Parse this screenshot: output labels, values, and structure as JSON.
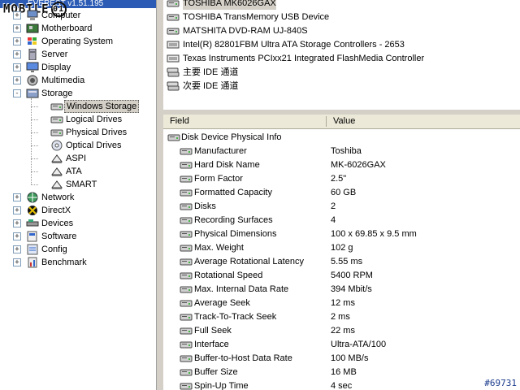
{
  "window": {
    "title": "EVEREST v1.51.195"
  },
  "watermark": {
    "text": "MOBILE",
    "circle": "01"
  },
  "tree": [
    {
      "label": "Computer",
      "icon": "computer-icon",
      "level": 0,
      "expander": "+"
    },
    {
      "label": "Motherboard",
      "icon": "motherboard-icon",
      "level": 0,
      "expander": "+"
    },
    {
      "label": "Operating System",
      "icon": "windows-icon",
      "level": 0,
      "expander": "+"
    },
    {
      "label": "Server",
      "icon": "server-icon",
      "level": 0,
      "expander": "+"
    },
    {
      "label": "Display",
      "icon": "monitor-icon",
      "level": 0,
      "expander": "+"
    },
    {
      "label": "Multimedia",
      "icon": "speaker-icon",
      "level": 0,
      "expander": "+"
    },
    {
      "label": "Storage",
      "icon": "storage-icon",
      "level": 0,
      "expander": "-"
    },
    {
      "label": "Windows Storage",
      "icon": "drive-icon",
      "level": 1,
      "selected": true
    },
    {
      "label": "Logical Drives",
      "icon": "drive-icon",
      "level": 1
    },
    {
      "label": "Physical Drives",
      "icon": "drive-icon",
      "level": 1
    },
    {
      "label": "Optical Drives",
      "icon": "cdrom-icon",
      "level": 1
    },
    {
      "label": "ASPI",
      "icon": "aspi-icon",
      "level": 1
    },
    {
      "label": "ATA",
      "icon": "ata-icon",
      "level": 1
    },
    {
      "label": "SMART",
      "icon": "smart-icon",
      "level": 1
    },
    {
      "label": "Network",
      "icon": "network-icon",
      "level": 0,
      "expander": "+"
    },
    {
      "label": "DirectX",
      "icon": "directx-icon",
      "level": 0,
      "expander": "+"
    },
    {
      "label": "Devices",
      "icon": "devices-icon",
      "level": 0,
      "expander": "+"
    },
    {
      "label": "Software",
      "icon": "software-icon",
      "level": 0,
      "expander": "+"
    },
    {
      "label": "Config",
      "icon": "config-icon",
      "level": 0,
      "expander": "+"
    },
    {
      "label": "Benchmark",
      "icon": "benchmark-icon",
      "level": 0,
      "expander": "+"
    }
  ],
  "devices": [
    {
      "label": "TOSHIBA MK6026GAX",
      "icon": "hard-drive-icon",
      "selected": true
    },
    {
      "label": "TOSHIBA TransMemory USB Device",
      "icon": "usb-drive-icon"
    },
    {
      "label": "MATSHITA DVD-RAM UJ-840S",
      "icon": "dvd-drive-icon"
    },
    {
      "label": "Intel(R) 82801FBM Ultra ATA Storage Controllers - 2653",
      "icon": "controller-icon"
    },
    {
      "label": "Texas Instruments PCIxx21 Integrated FlashMedia Controller",
      "icon": "controller-icon"
    },
    {
      "label": "主要 IDE 通道",
      "icon": "ide-channel-icon"
    },
    {
      "label": "次要 IDE 通道",
      "icon": "ide-channel-icon"
    }
  ],
  "details": {
    "columns": {
      "field": "Field",
      "value": "Value"
    },
    "group": "Disk Device Physical Info",
    "rows": [
      {
        "field": "Manufacturer",
        "value": "Toshiba"
      },
      {
        "field": "Hard Disk Name",
        "value": "MK-6026GAX"
      },
      {
        "field": "Form Factor",
        "value": "2.5\""
      },
      {
        "field": "Formatted Capacity",
        "value": "60 GB"
      },
      {
        "field": "Disks",
        "value": "2"
      },
      {
        "field": "Recording Surfaces",
        "value": "4"
      },
      {
        "field": "Physical Dimensions",
        "value": "100 x 69.85 x 9.5 mm"
      },
      {
        "field": "Max. Weight",
        "value": "102 g"
      },
      {
        "field": "Average Rotational Latency",
        "value": "5.55 ms"
      },
      {
        "field": "Rotational Speed",
        "value": "5400 RPM"
      },
      {
        "field": "Max. Internal Data Rate",
        "value": "394 Mbit/s"
      },
      {
        "field": "Average Seek",
        "value": "12 ms"
      },
      {
        "field": "Track-To-Track Seek",
        "value": "2 ms"
      },
      {
        "field": "Full Seek",
        "value": "22 ms"
      },
      {
        "field": "Interface",
        "value": "Ultra-ATA/100"
      },
      {
        "field": "Buffer-to-Host Data Rate",
        "value": "100 MB/s"
      },
      {
        "field": "Buffer Size",
        "value": "16 MB"
      },
      {
        "field": "Spin-Up Time",
        "value": "4 sec"
      }
    ]
  },
  "badge": "#69731",
  "colors": {
    "selection": "#d4d0c8",
    "header": "#ece9d8",
    "title": "#2b5bb5",
    "badge": "#1a3a8c"
  }
}
